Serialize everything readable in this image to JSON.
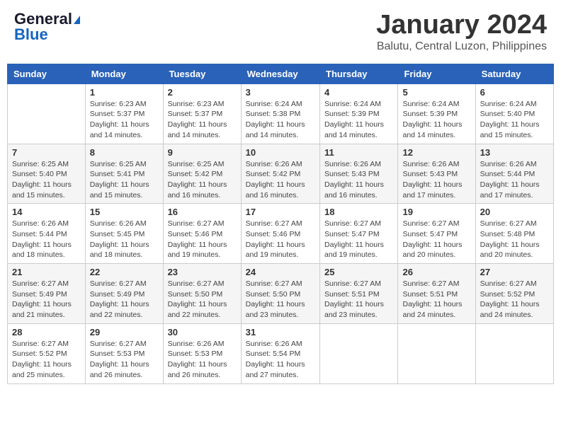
{
  "logo": {
    "line1": "General",
    "line2": "Blue"
  },
  "title": "January 2024",
  "location": "Balutu, Central Luzon, Philippines",
  "days_of_week": [
    "Sunday",
    "Monday",
    "Tuesday",
    "Wednesday",
    "Thursday",
    "Friday",
    "Saturday"
  ],
  "weeks": [
    [
      {
        "day": "",
        "sunrise": "",
        "sunset": "",
        "daylight": ""
      },
      {
        "day": "1",
        "sunrise": "6:23 AM",
        "sunset": "5:37 PM",
        "daylight": "11 hours and 14 minutes."
      },
      {
        "day": "2",
        "sunrise": "6:23 AM",
        "sunset": "5:37 PM",
        "daylight": "11 hours and 14 minutes."
      },
      {
        "day": "3",
        "sunrise": "6:24 AM",
        "sunset": "5:38 PM",
        "daylight": "11 hours and 14 minutes."
      },
      {
        "day": "4",
        "sunrise": "6:24 AM",
        "sunset": "5:39 PM",
        "daylight": "11 hours and 14 minutes."
      },
      {
        "day": "5",
        "sunrise": "6:24 AM",
        "sunset": "5:39 PM",
        "daylight": "11 hours and 14 minutes."
      },
      {
        "day": "6",
        "sunrise": "6:24 AM",
        "sunset": "5:40 PM",
        "daylight": "11 hours and 15 minutes."
      }
    ],
    [
      {
        "day": "7",
        "sunrise": "6:25 AM",
        "sunset": "5:40 PM",
        "daylight": "11 hours and 15 minutes."
      },
      {
        "day": "8",
        "sunrise": "6:25 AM",
        "sunset": "5:41 PM",
        "daylight": "11 hours and 15 minutes."
      },
      {
        "day": "9",
        "sunrise": "6:25 AM",
        "sunset": "5:42 PM",
        "daylight": "11 hours and 16 minutes."
      },
      {
        "day": "10",
        "sunrise": "6:26 AM",
        "sunset": "5:42 PM",
        "daylight": "11 hours and 16 minutes."
      },
      {
        "day": "11",
        "sunrise": "6:26 AM",
        "sunset": "5:43 PM",
        "daylight": "11 hours and 16 minutes."
      },
      {
        "day": "12",
        "sunrise": "6:26 AM",
        "sunset": "5:43 PM",
        "daylight": "11 hours and 17 minutes."
      },
      {
        "day": "13",
        "sunrise": "6:26 AM",
        "sunset": "5:44 PM",
        "daylight": "11 hours and 17 minutes."
      }
    ],
    [
      {
        "day": "14",
        "sunrise": "6:26 AM",
        "sunset": "5:44 PM",
        "daylight": "11 hours and 18 minutes."
      },
      {
        "day": "15",
        "sunrise": "6:26 AM",
        "sunset": "5:45 PM",
        "daylight": "11 hours and 18 minutes."
      },
      {
        "day": "16",
        "sunrise": "6:27 AM",
        "sunset": "5:46 PM",
        "daylight": "11 hours and 19 minutes."
      },
      {
        "day": "17",
        "sunrise": "6:27 AM",
        "sunset": "5:46 PM",
        "daylight": "11 hours and 19 minutes."
      },
      {
        "day": "18",
        "sunrise": "6:27 AM",
        "sunset": "5:47 PM",
        "daylight": "11 hours and 19 minutes."
      },
      {
        "day": "19",
        "sunrise": "6:27 AM",
        "sunset": "5:47 PM",
        "daylight": "11 hours and 20 minutes."
      },
      {
        "day": "20",
        "sunrise": "6:27 AM",
        "sunset": "5:48 PM",
        "daylight": "11 hours and 20 minutes."
      }
    ],
    [
      {
        "day": "21",
        "sunrise": "6:27 AM",
        "sunset": "5:49 PM",
        "daylight": "11 hours and 21 minutes."
      },
      {
        "day": "22",
        "sunrise": "6:27 AM",
        "sunset": "5:49 PM",
        "daylight": "11 hours and 22 minutes."
      },
      {
        "day": "23",
        "sunrise": "6:27 AM",
        "sunset": "5:50 PM",
        "daylight": "11 hours and 22 minutes."
      },
      {
        "day": "24",
        "sunrise": "6:27 AM",
        "sunset": "5:50 PM",
        "daylight": "11 hours and 23 minutes."
      },
      {
        "day": "25",
        "sunrise": "6:27 AM",
        "sunset": "5:51 PM",
        "daylight": "11 hours and 23 minutes."
      },
      {
        "day": "26",
        "sunrise": "6:27 AM",
        "sunset": "5:51 PM",
        "daylight": "11 hours and 24 minutes."
      },
      {
        "day": "27",
        "sunrise": "6:27 AM",
        "sunset": "5:52 PM",
        "daylight": "11 hours and 24 minutes."
      }
    ],
    [
      {
        "day": "28",
        "sunrise": "6:27 AM",
        "sunset": "5:52 PM",
        "daylight": "11 hours and 25 minutes."
      },
      {
        "day": "29",
        "sunrise": "6:27 AM",
        "sunset": "5:53 PM",
        "daylight": "11 hours and 26 minutes."
      },
      {
        "day": "30",
        "sunrise": "6:26 AM",
        "sunset": "5:53 PM",
        "daylight": "11 hours and 26 minutes."
      },
      {
        "day": "31",
        "sunrise": "6:26 AM",
        "sunset": "5:54 PM",
        "daylight": "11 hours and 27 minutes."
      },
      {
        "day": "",
        "sunrise": "",
        "sunset": "",
        "daylight": ""
      },
      {
        "day": "",
        "sunrise": "",
        "sunset": "",
        "daylight": ""
      },
      {
        "day": "",
        "sunrise": "",
        "sunset": "",
        "daylight": ""
      }
    ]
  ]
}
